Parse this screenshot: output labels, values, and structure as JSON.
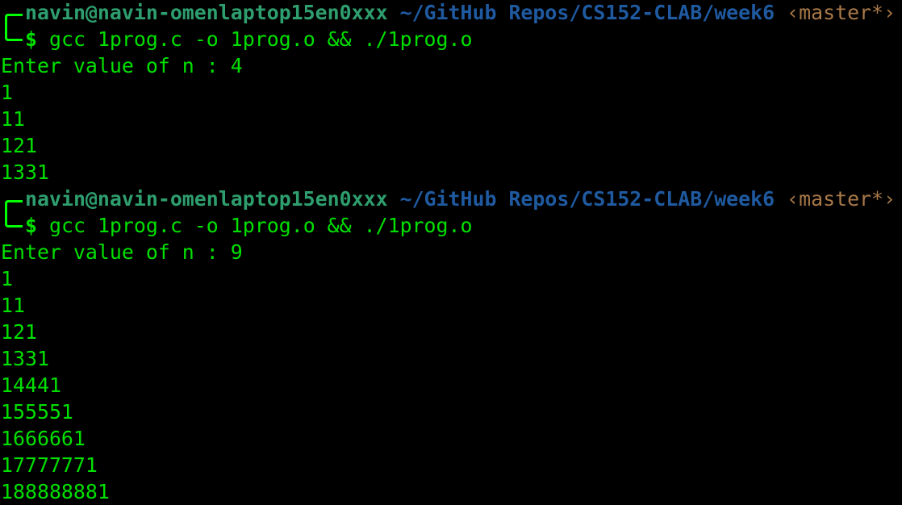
{
  "sessions": [
    {
      "user_host": "navin@navin-omenlaptop15en0xxx",
      "path": "~/GitHub Repos/CS152-CLAB/week6",
      "branch": "‹master*›",
      "symbol": "$",
      "command": "gcc 1prog.c -o 1prog.o && ./1prog.o",
      "output": [
        "Enter value of n : 4",
        "1",
        "11",
        "121",
        "1331"
      ]
    },
    {
      "user_host": "navin@navin-omenlaptop15en0xxx",
      "path": "~/GitHub Repos/CS152-CLAB/week6",
      "branch": "‹master*›",
      "symbol": "$",
      "command": "gcc 1prog.c -o 1prog.o && ./1prog.o",
      "output": [
        "Enter value of n : 9",
        "1",
        "11",
        "121",
        "1331",
        "14441",
        "155551",
        "1666661",
        "17777771",
        "188888881"
      ]
    }
  ]
}
